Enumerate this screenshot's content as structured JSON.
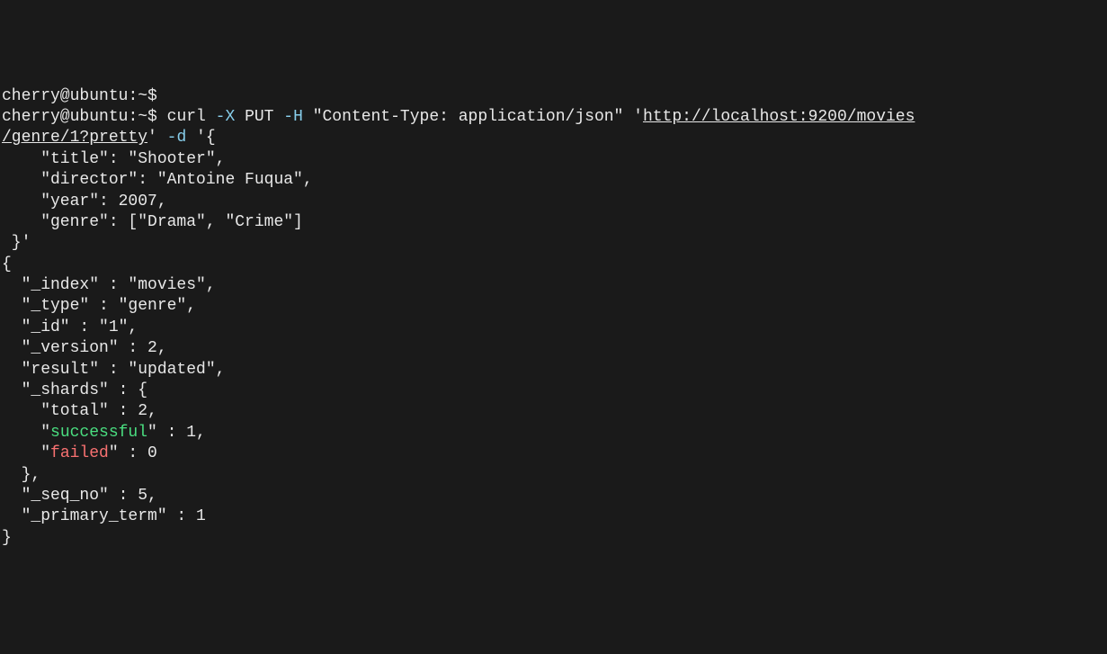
{
  "prompt1": {
    "user_host": "cherry@ubuntu",
    "path": ":~$",
    "input": ""
  },
  "prompt2": {
    "user_host": "cherry@ubuntu",
    "path": ":~$",
    "cmd": " curl ",
    "flag1": "-X",
    "arg1": " PUT ",
    "flag2": "-H",
    "arg2": " \"Content-Type: application/json\" '",
    "url1": "http://localhost:9200/movies",
    "url2": "/genre/1?pretty",
    "after_url": "' ",
    "flag3": "-d",
    "json_body": " '{\n    \"title\": \"Shooter\",\n    \"director\": \"Antoine Fuqua\",\n    \"year\": 2007,\n    \"genre\": [\"Drama\", \"Crime\"]\n }'"
  },
  "response": {
    "open": "{",
    "l1": "  \"_index\" : \"movies\",",
    "l2": "  \"_type\" : \"genre\",",
    "l3": "  \"_id\" : \"1\",",
    "l4": "  \"_version\" : 2,",
    "l5": "  \"result\" : \"updated\",",
    "l6": "  \"_shards\" : {",
    "l7a": "    \"total\" : 2,",
    "l8_prefix": "    \"",
    "l8_key": "successful",
    "l8_suffix": "\" : 1,",
    "l9_prefix": "    \"",
    "l9_key": "failed",
    "l9_suffix": "\" : 0",
    "l10": "  },",
    "l11": "  \"_seq_no\" : 5,",
    "l12": "  \"_primary_term\" : 1",
    "close": "}"
  }
}
